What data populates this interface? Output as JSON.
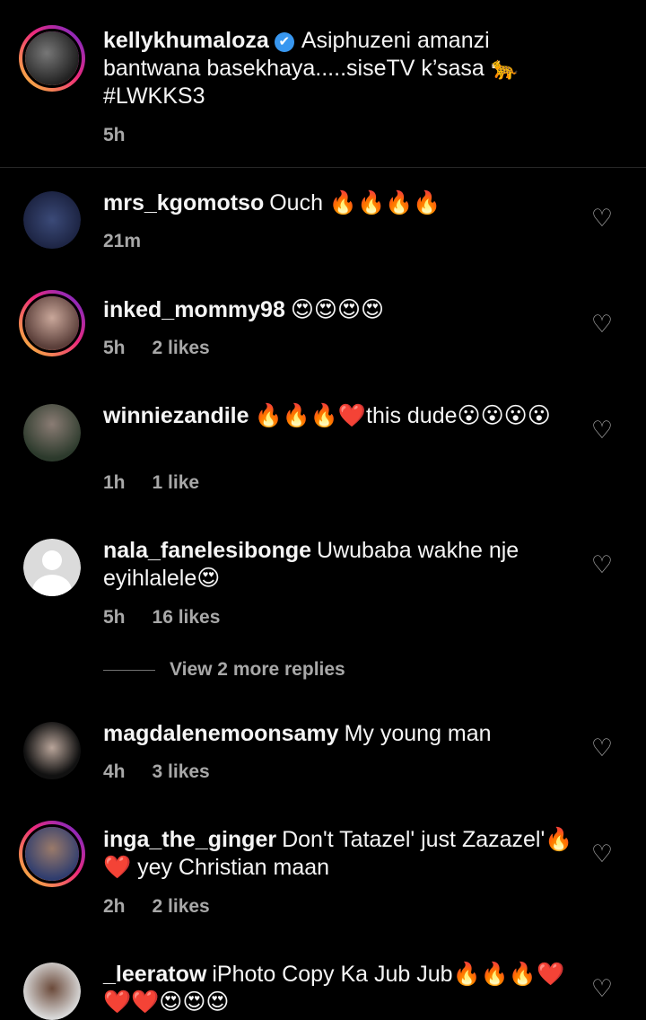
{
  "caption": {
    "username": "kellykhumaloza",
    "verified_glyph": "✔",
    "text": "Asiphuzeni amanzi bantwana basekhaya.....siseTV k’sasa 🐆 #LWKKS3",
    "time": "5h"
  },
  "comments": [
    {
      "username": "mrs_kgomotso",
      "text": "Ouch 🔥🔥🔥🔥",
      "time": "21m",
      "likes": ""
    },
    {
      "username": "inked_mommy98",
      "text": "😍😍😍😍",
      "time": "5h",
      "likes": "2 likes"
    },
    {
      "username": "winniezandile",
      "text": "🔥🔥🔥❤️this dude😮😮😮😮",
      "time": "1h",
      "likes": "1 like"
    },
    {
      "username": "nala_fanelesibonge",
      "text": "Uwubaba wakhe nje eyihlalele😍",
      "time": "5h",
      "likes": "16 likes"
    },
    {
      "username": "magdalenemoonsamy",
      "text": "My young man",
      "time": "4h",
      "likes": "3 likes"
    },
    {
      "username": "inga_the_ginger",
      "text": "Don't Tatazel' just Zazazel'🔥❤️ yey Christian maan",
      "time": "2h",
      "likes": "2 likes"
    },
    {
      "username": "_leeratow",
      "text": "iPhoto Copy Ka Jub Jub🔥🔥🔥❤️❤️❤️😍😍😍",
      "time": "",
      "likes": ""
    }
  ],
  "view_replies": "View 2 more replies",
  "icons": {
    "like": "heart-outline-icon",
    "heart_glyph": "♡"
  }
}
